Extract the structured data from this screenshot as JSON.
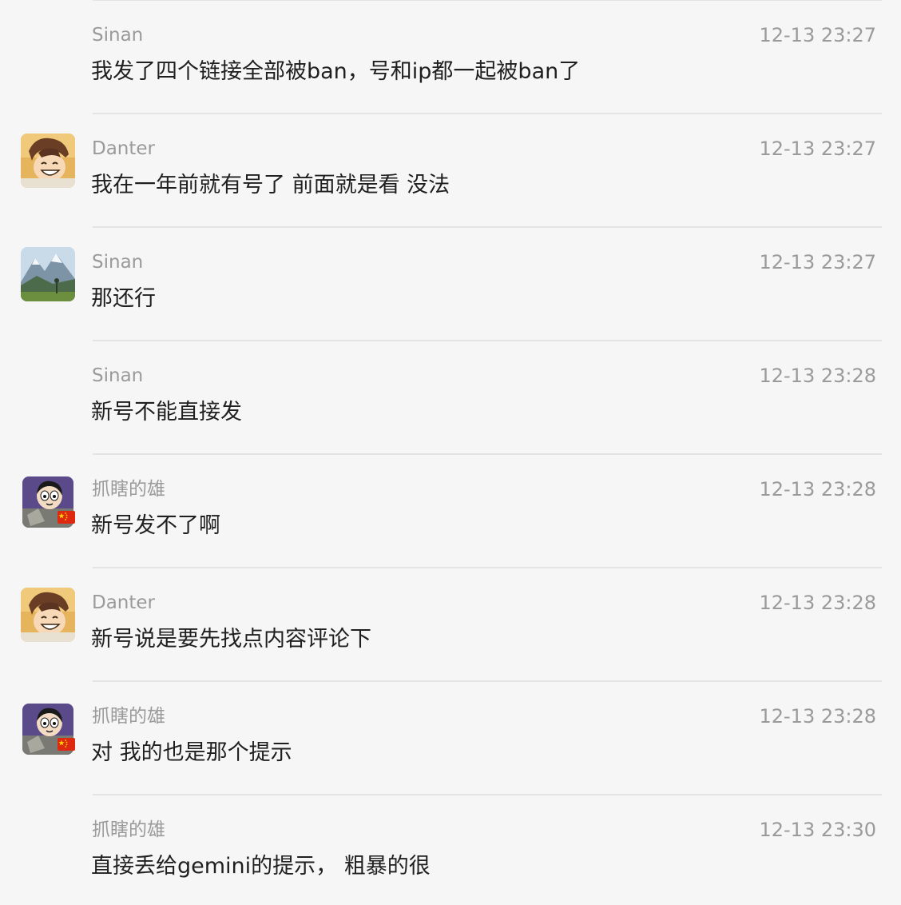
{
  "messages": [
    {
      "sender": "Sinan",
      "time": "12-13 23:27",
      "text": "我发了四个链接全部被ban，号和ip都一起被ban了",
      "avatar": "none"
    },
    {
      "sender": "Danter",
      "time": "12-13 23:27",
      "text": "我在一年前就有号了 前面就是看 没法",
      "avatar": "anime-avatar"
    },
    {
      "sender": "Sinan",
      "time": "12-13 23:27",
      "text": "那还行",
      "avatar": "mountain-avatar"
    },
    {
      "sender": "Sinan",
      "time": "12-13 23:28",
      "text": "新号不能直接发",
      "avatar": "none"
    },
    {
      "sender": "抓瞎的雄",
      "time": "12-13 23:28",
      "text": "新号发不了啊",
      "avatar": "cartoon-avatar"
    },
    {
      "sender": "Danter",
      "time": "12-13 23:28",
      "text": "新号说是要先找点内容评论下",
      "avatar": "anime-avatar"
    },
    {
      "sender": "抓瞎的雄",
      "time": "12-13 23:28",
      "text": "对 我的也是那个提示",
      "avatar": "cartoon-avatar"
    },
    {
      "sender": "抓瞎的雄",
      "time": "12-13 23:30",
      "text": "直接丢给gemini的提示， 粗暴的很",
      "avatar": "none"
    }
  ],
  "colors": {
    "background": "#f6f6f6",
    "divider": "#e4e4e4",
    "meta_text": "#9a9a9a",
    "body_text": "#1f1f1f"
  }
}
